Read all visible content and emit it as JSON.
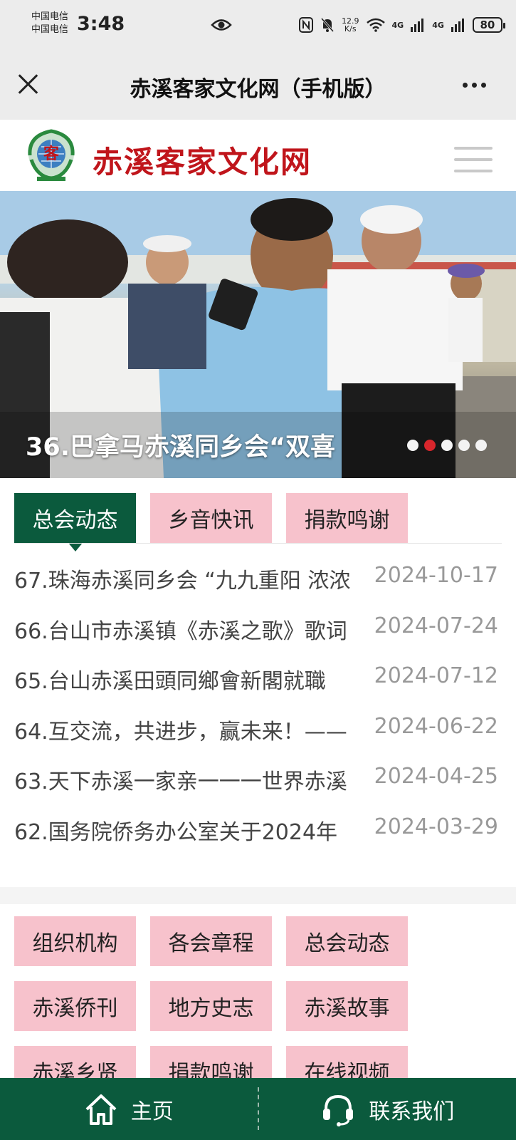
{
  "status_bar": {
    "carrier1": "中国电信",
    "carrier2": "中国电信",
    "time": "3:48",
    "speed_value": "12.9",
    "speed_unit": "K/s",
    "net1": "4G",
    "net2": "4G",
    "battery": "80"
  },
  "titlebar": {
    "title": "赤溪客家文化网（手机版）"
  },
  "site": {
    "logo_text": "赤溪客家文化网"
  },
  "banner": {
    "caption": "36.巴拿马赤溪同乡会“双喜",
    "slide_count": 5,
    "active_slide": 2
  },
  "tabs": [
    {
      "label": "总会动态",
      "active": true
    },
    {
      "label": "乡音快讯",
      "active": false
    },
    {
      "label": "捐款鸣谢",
      "active": false
    }
  ],
  "news": [
    {
      "title": "67.珠海赤溪同乡会 “九九重阳 浓浓",
      "date": "2024-10-17"
    },
    {
      "title": "66.台山市赤溪镇《赤溪之歌》歌词",
      "date": "2024-07-24"
    },
    {
      "title": "65.台山赤溪田頭同鄉會新閣就職",
      "date": "2024-07-12"
    },
    {
      "title": "64.互交流，共进步，赢未来！——",
      "date": "2024-06-22"
    },
    {
      "title": "63.天下赤溪一家亲一一一世界赤溪",
      "date": "2024-04-25"
    },
    {
      "title": "62.国务院侨务办公室关于2024年",
      "date": "2024-03-29"
    }
  ],
  "categories": [
    "组织机构",
    "各会章程",
    "总会动态",
    "赤溪侨刊",
    "地方史志",
    "赤溪故事",
    "赤溪乡贤",
    "捐款鸣谢",
    "在线视频"
  ],
  "bottom_nav": {
    "home": "主页",
    "contact": "联系我们"
  },
  "colors": {
    "primary_green": "#0b5a3d",
    "tab_pink": "#f7c2cc",
    "logo_red": "#c0151b",
    "dot_active": "#d8262c"
  }
}
